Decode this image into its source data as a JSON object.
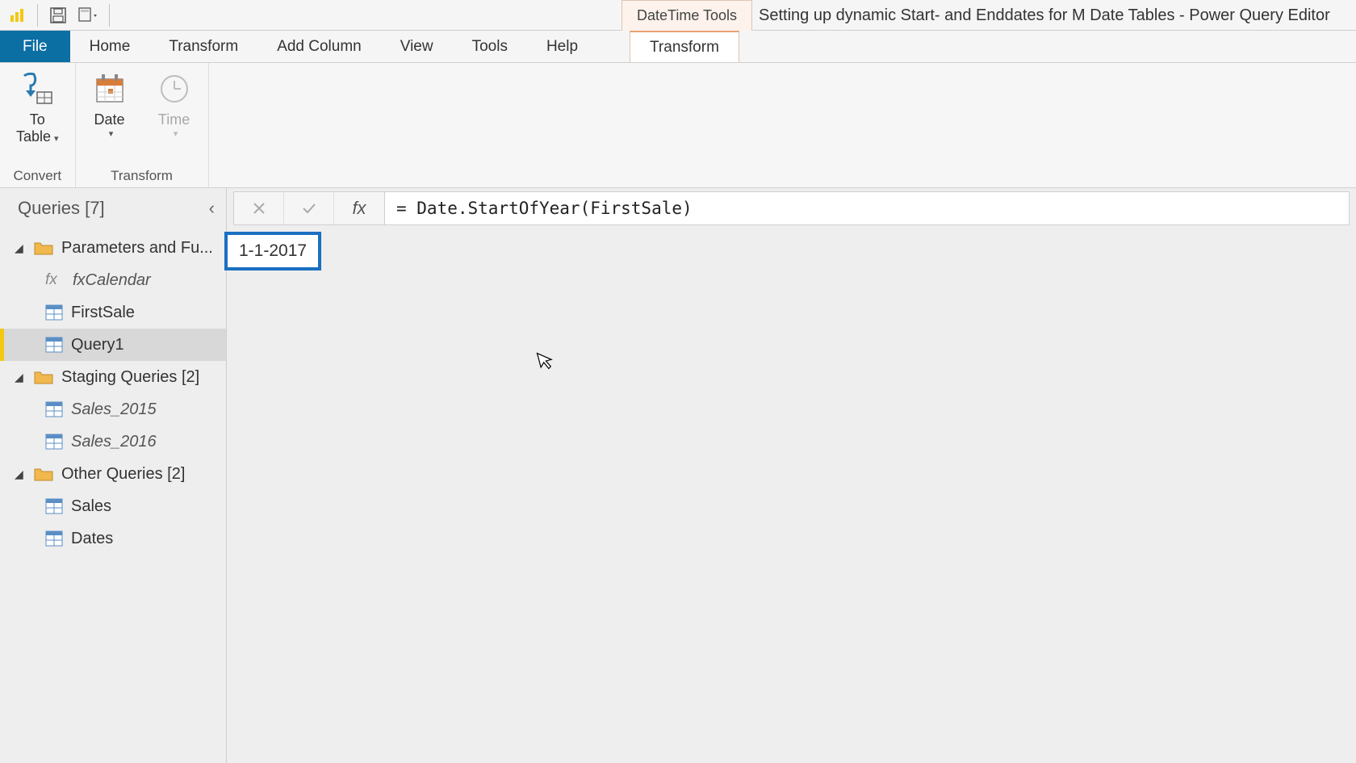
{
  "titlebar": {
    "contextual_group": "DateTime Tools",
    "window_title": "Setting up dynamic Start- and Enddates for M Date Tables - Power Query Editor"
  },
  "ribbon_tabs": {
    "file": "File",
    "home": "Home",
    "transform": "Transform",
    "add_column": "Add Column",
    "view": "View",
    "tools": "Tools",
    "help": "Help",
    "contextual_transform": "Transform"
  },
  "ribbon": {
    "convert": {
      "to_table_line1": "To",
      "to_table_line2": "Table",
      "group_label": "Convert"
    },
    "transform": {
      "date": "Date",
      "time": "Time",
      "group_label": "Transform"
    }
  },
  "queries_pane": {
    "header": "Queries [7]",
    "folders": [
      {
        "label": "Parameters and Fu...",
        "items": [
          {
            "type": "fx",
            "label": "fxCalendar",
            "italic": true
          },
          {
            "type": "table",
            "label": "FirstSale",
            "italic": false
          },
          {
            "type": "table",
            "label": "Query1",
            "italic": false,
            "selected": true
          }
        ]
      },
      {
        "label": "Staging Queries [2]",
        "items": [
          {
            "type": "table",
            "label": "Sales_2015",
            "italic": true
          },
          {
            "type": "table",
            "label": "Sales_2016",
            "italic": true
          }
        ]
      },
      {
        "label": "Other Queries [2]",
        "items": [
          {
            "type": "table",
            "label": "Sales",
            "italic": false
          },
          {
            "type": "table",
            "label": "Dates",
            "italic": false
          }
        ]
      }
    ]
  },
  "formula_bar": {
    "formula": "= Date.StartOfYear(FirstSale)"
  },
  "result": {
    "value": "1-1-2017"
  }
}
